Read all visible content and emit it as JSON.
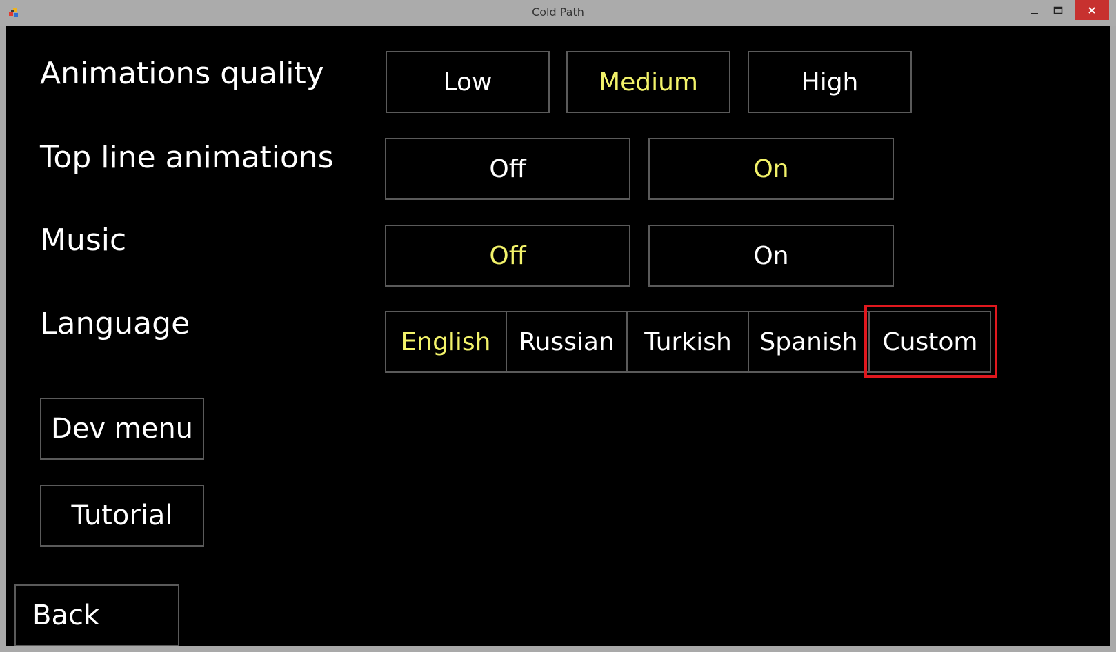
{
  "window": {
    "title": "Cold Path",
    "controls": {
      "minimize_icon": "minimize-icon",
      "maximize_icon": "maximize-icon",
      "close_icon": "close-icon"
    }
  },
  "settings": {
    "animations_quality": {
      "label": "Animations quality",
      "options": [
        "Low",
        "Medium",
        "High"
      ],
      "selected": "Medium"
    },
    "top_line_animations": {
      "label": "Top line animations",
      "options": [
        "Off",
        "On"
      ],
      "selected": "On"
    },
    "music": {
      "label": "Music",
      "options": [
        "Off",
        "On"
      ],
      "selected": "Off"
    },
    "language": {
      "label": "Language",
      "options": [
        "English",
        "Russian",
        "Turkish",
        "Spanish",
        "Custom"
      ],
      "selected": "English"
    }
  },
  "buttons": {
    "dev_menu": "Dev menu",
    "tutorial": "Tutorial",
    "back": "Back"
  },
  "colors": {
    "background": "#000000",
    "text": "#ffffff",
    "selected_text": "#f3f36a",
    "border": "#5a5a5a",
    "highlight": "#e0181e"
  }
}
